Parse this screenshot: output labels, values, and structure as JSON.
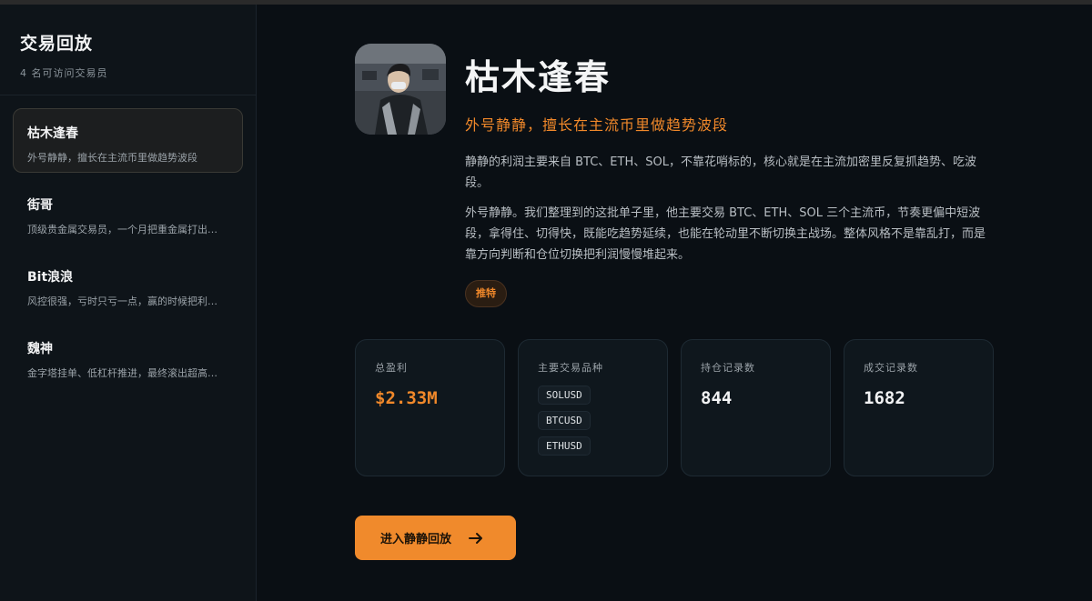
{
  "sidebar": {
    "title": "交易回放",
    "subtitle": "4 名可访问交易员",
    "traders": [
      {
        "name": "枯木逢春",
        "desc": "外号静静，擅长在主流币里做趋势波段"
      },
      {
        "name": "街哥",
        "desc": "顶级贵金属交易员，一个月把重金属打出…"
      },
      {
        "name": "Bit浪浪",
        "desc": "风控很强，亏时只亏一点，赢的时候把利…"
      },
      {
        "name": "魏神",
        "desc": "金字塔挂单、低杠杆推进，最终滚出超高…"
      }
    ]
  },
  "profile": {
    "name": "枯木逢春",
    "tagline": "外号静静，擅长在主流币里做趋势波段",
    "para1": "静静的利润主要来自 BTC、ETH、SOL，不靠花哨标的，核心就是在主流加密里反复抓趋势、吃波段。",
    "para2": "外号静静。我们整理到的这批单子里，他主要交易 BTC、ETH、SOL 三个主流币，节奏更偏中短波段，拿得住、切得快，既能吃趋势延续，也能在轮动里不断切换主战场。整体风格不是靠乱打，而是靠方向判断和仓位切换把利润慢慢堆起来。",
    "tag": "推特"
  },
  "stats": {
    "profit_label": "总盈利",
    "profit_value": "$2.33M",
    "symbols_label": "主要交易品种",
    "symbols": [
      "SOLUSD",
      "BTCUSD",
      "ETHUSD"
    ],
    "positions_label": "持仓记录数",
    "positions_value": "844",
    "trades_label": "成交记录数",
    "trades_value": "1682"
  },
  "actions": {
    "enter_label": "进入静静回放"
  },
  "colors": {
    "accent": "#f08a2c",
    "background": "#0a0f14"
  }
}
